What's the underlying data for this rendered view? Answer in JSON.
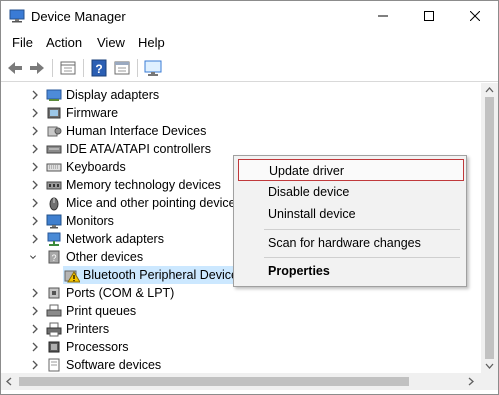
{
  "window": {
    "title": "Device Manager"
  },
  "menu": [
    "File",
    "Action",
    "View",
    "Help"
  ],
  "toolbar": {
    "buttons": [
      "back-icon",
      "forward-icon",
      "properties-view-icon",
      "help-icon",
      "details-icon",
      "monitor-icon"
    ]
  },
  "tree": {
    "items": [
      {
        "label": "Display adapters",
        "icon": "display-adapter-icon",
        "expanded": false
      },
      {
        "label": "Firmware",
        "icon": "firmware-icon",
        "expanded": false
      },
      {
        "label": "Human Interface Devices",
        "icon": "hid-icon",
        "expanded": false
      },
      {
        "label": "IDE ATA/ATAPI controllers",
        "icon": "ide-controller-icon",
        "expanded": false
      },
      {
        "label": "Keyboards",
        "icon": "keyboard-icon",
        "expanded": false
      },
      {
        "label": "Memory technology devices",
        "icon": "memory-icon",
        "expanded": false
      },
      {
        "label": "Mice and other pointing devices",
        "icon": "mouse-icon",
        "expanded": false
      },
      {
        "label": "Monitors",
        "icon": "monitor-icon",
        "expanded": false
      },
      {
        "label": "Network adapters",
        "icon": "network-adapter-icon",
        "expanded": false
      },
      {
        "label": "Other devices",
        "icon": "other-devices-icon",
        "expanded": true
      },
      {
        "label": "Bluetooth Peripheral Device",
        "icon": "warning-device-icon",
        "child": true,
        "selected": true
      },
      {
        "label": "Ports (COM & LPT)",
        "icon": "port-icon",
        "expanded": false
      },
      {
        "label": "Print queues",
        "icon": "print-queue-icon",
        "expanded": false
      },
      {
        "label": "Printers",
        "icon": "printer-icon",
        "expanded": false
      },
      {
        "label": "Processors",
        "icon": "processor-icon",
        "expanded": false
      },
      {
        "label": "Software devices",
        "icon": "software-device-icon",
        "expanded": false
      }
    ]
  },
  "context_menu": {
    "items": [
      {
        "label": "Update driver",
        "highlighted": true
      },
      {
        "label": "Disable device"
      },
      {
        "label": "Uninstall device"
      },
      {
        "label": "Scan for hardware changes"
      },
      {
        "label": "Properties",
        "bold": true
      }
    ]
  },
  "colors": {
    "selection": "#cce8ff",
    "highlight_border": "#c0393b",
    "menu_bg": "#f2f2f2"
  }
}
